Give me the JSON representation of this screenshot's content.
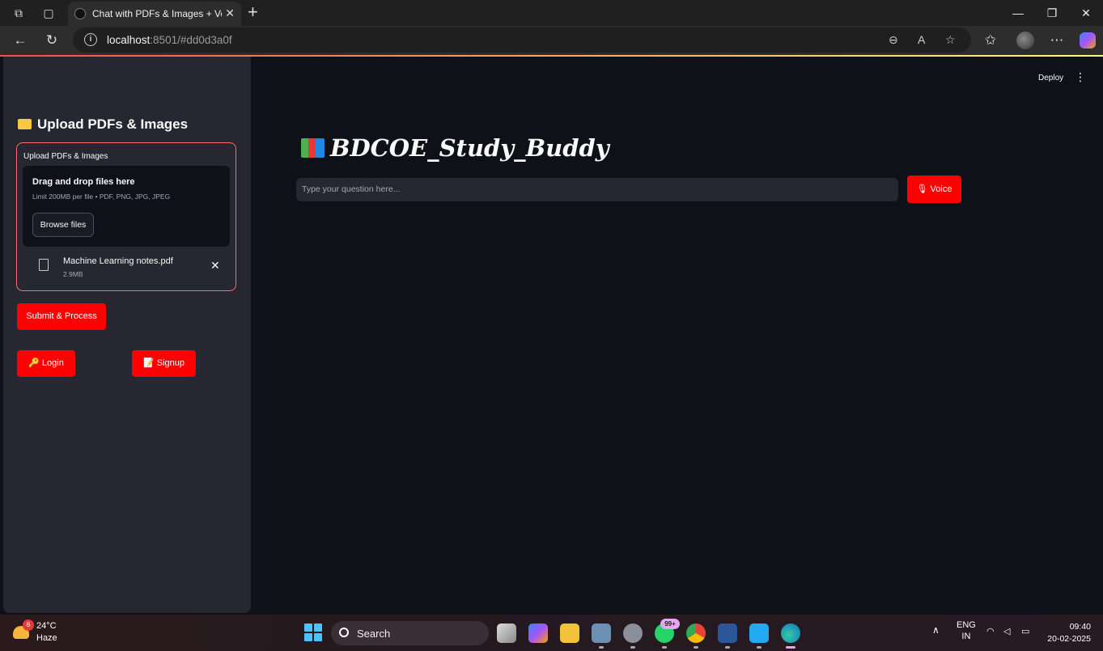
{
  "browser": {
    "tab_title": "Chat with PDFs & Images + Voice",
    "url_host": "localhost",
    "url_rest": ":8501/#dd0d3a0f"
  },
  "sidebar": {
    "heading": "Upload PDFs & Images",
    "uploader": {
      "label": "Upload PDFs & Images",
      "drop_title": "Drag and drop files here",
      "limit_text": "Limit 200MB per file • PDF, PNG, JPG, JPEG",
      "browse_label": "Browse files",
      "file": {
        "name": "Machine Learning notes.pdf",
        "size": "2.9MB"
      }
    },
    "submit_label": "Submit & Process",
    "login_label": "🔑 Login",
    "signup_label": "📝 Signup"
  },
  "header": {
    "deploy_label": "Deploy"
  },
  "main": {
    "title": "BDCOE_Study_Buddy",
    "question_placeholder": "Type your question here...",
    "voice_label": "🎙 Voice"
  },
  "taskbar": {
    "weather_badge": "6",
    "temperature": "24°C",
    "condition": "Haze",
    "search_label": "Search",
    "whatsapp_badge": "99+",
    "language_line1": "ENG",
    "language_line2": "IN",
    "time": "09:40",
    "date": "20-02-2025"
  },
  "colors": {
    "accent_red": "#ff0000",
    "app_bg": "#0e1117",
    "sidebar_bg": "#262730",
    "uploader_border": "#ff6b6b"
  }
}
